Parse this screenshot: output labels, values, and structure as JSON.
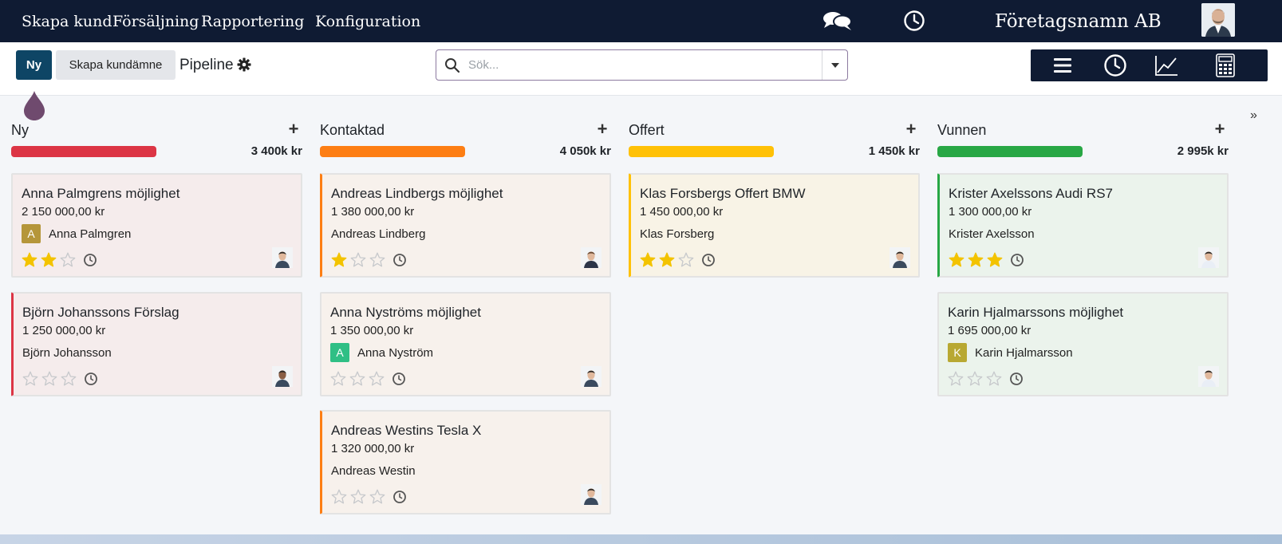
{
  "topbar": {
    "menu": [
      "Skapa kund",
      "Försäljning",
      "Rapportering",
      "Konfiguration"
    ],
    "company": "Företagsnamn AB",
    "icons": [
      "chat-icon",
      "clock-icon",
      "user-avatar"
    ]
  },
  "control": {
    "new_label": "Ny",
    "create_lead_label": "Skapa kundämne",
    "breadcrumb": "Pipeline",
    "search_placeholder": "Sök...",
    "views": [
      "list-view-icon",
      "activity-view-icon",
      "graph-view-icon",
      "pivot-view-icon"
    ]
  },
  "columns": [
    {
      "title": "Ny",
      "total": "3 400k kr",
      "color": "#dc3545",
      "cards": [
        {
          "title": "Anna Palmgrens möjlighet",
          "amount": "2 150 000,00 kr",
          "contact": "Anna Palmgren",
          "badge": "A",
          "badge_color": "#b5963a",
          "stars": 2,
          "accent": ""
        },
        {
          "title": "Björn Johanssons Förslag",
          "amount": "1 250 000,00 kr",
          "contact": "Björn Johansson",
          "badge": "",
          "badge_color": "",
          "stars": 0,
          "accent": "#dc3545"
        }
      ]
    },
    {
      "title": "Kontaktad",
      "total": "4 050k kr",
      "color": "#fd7e14",
      "cards": [
        {
          "title": "Andreas Lindbergs möjlighet",
          "amount": "1 380 000,00 kr",
          "contact": "Andreas Lindberg",
          "badge": "",
          "badge_color": "",
          "stars": 1,
          "accent": "#fd7e14"
        },
        {
          "title": "Anna Nyströms möjlighet",
          "amount": "1 350 000,00 kr",
          "contact": "Anna Nyström",
          "badge": "A",
          "badge_color": "#2fbf85",
          "stars": 0,
          "accent": ""
        },
        {
          "title": "Andreas Westins Tesla X",
          "amount": "1 320 000,00 kr",
          "contact": "Andreas Westin",
          "badge": "",
          "badge_color": "",
          "stars": 0,
          "accent": "#fd7e14"
        }
      ]
    },
    {
      "title": "Offert",
      "total": "1 450k kr",
      "color": "#ffc107",
      "cards": [
        {
          "title": "Klas Forsbergs Offert BMW",
          "amount": "1 450 000,00 kr",
          "contact": "Klas Forsberg",
          "badge": "",
          "badge_color": "",
          "stars": 2,
          "accent": "#ffc107"
        }
      ]
    },
    {
      "title": "Vunnen",
      "total": "2 995k kr",
      "color": "#28a745",
      "cards": [
        {
          "title": "Krister Axelssons Audi RS7",
          "amount": "1 300 000,00 kr",
          "contact": "Krister Axelsson",
          "badge": "",
          "badge_color": "",
          "stars": 3,
          "accent": "#28a745"
        },
        {
          "title": "Karin Hjalmarssons möjlighet",
          "amount": "1 695 000,00 kr",
          "contact": "Karin Hjalmarsson",
          "badge": "K",
          "badge_color": "#b8a832",
          "stars": 0,
          "accent": ""
        }
      ]
    }
  ],
  "colors": {
    "navbar": "#0f1b33",
    "primary": "#0e4565",
    "star_on": "#f3c300",
    "star_off": "#c7c9cc"
  }
}
